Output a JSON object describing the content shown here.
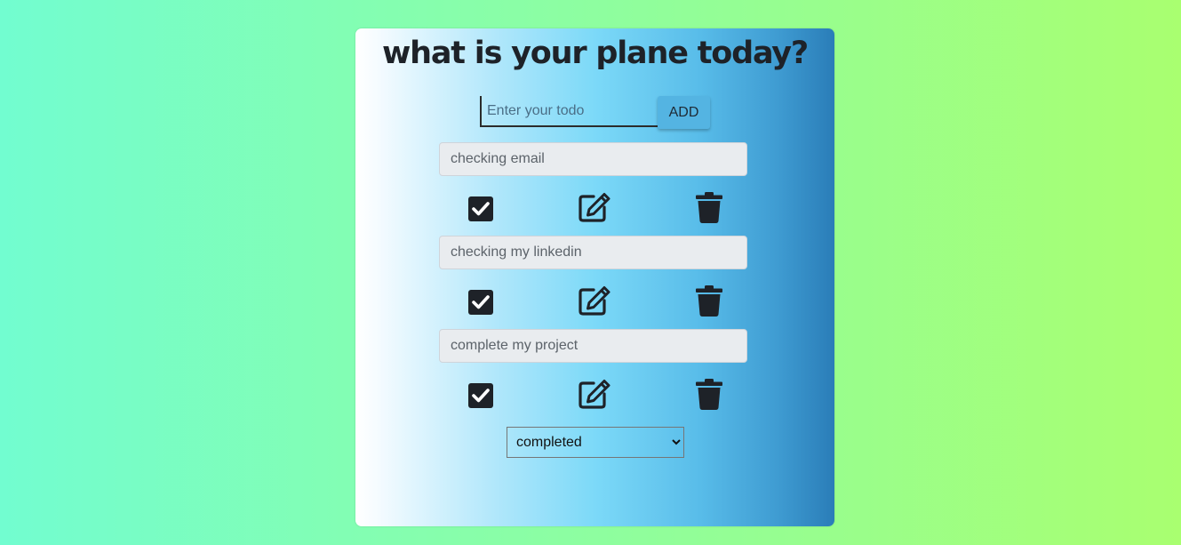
{
  "header": {
    "title": "what is your plane today?"
  },
  "form": {
    "placeholder": "Enter your todo",
    "add_label": "ADD"
  },
  "todos": [
    {
      "text": "checking email",
      "completed": true
    },
    {
      "text": "checking my linkedin",
      "completed": true
    },
    {
      "text": "complete my project",
      "completed": true
    }
  ],
  "icons": {
    "check": "check-square-icon",
    "edit": "edit-icon",
    "delete": "trash-icon"
  },
  "filter": {
    "selected": "completed"
  },
  "colors": {
    "icon": "#1e2228",
    "add_button": "#54b4e2"
  }
}
